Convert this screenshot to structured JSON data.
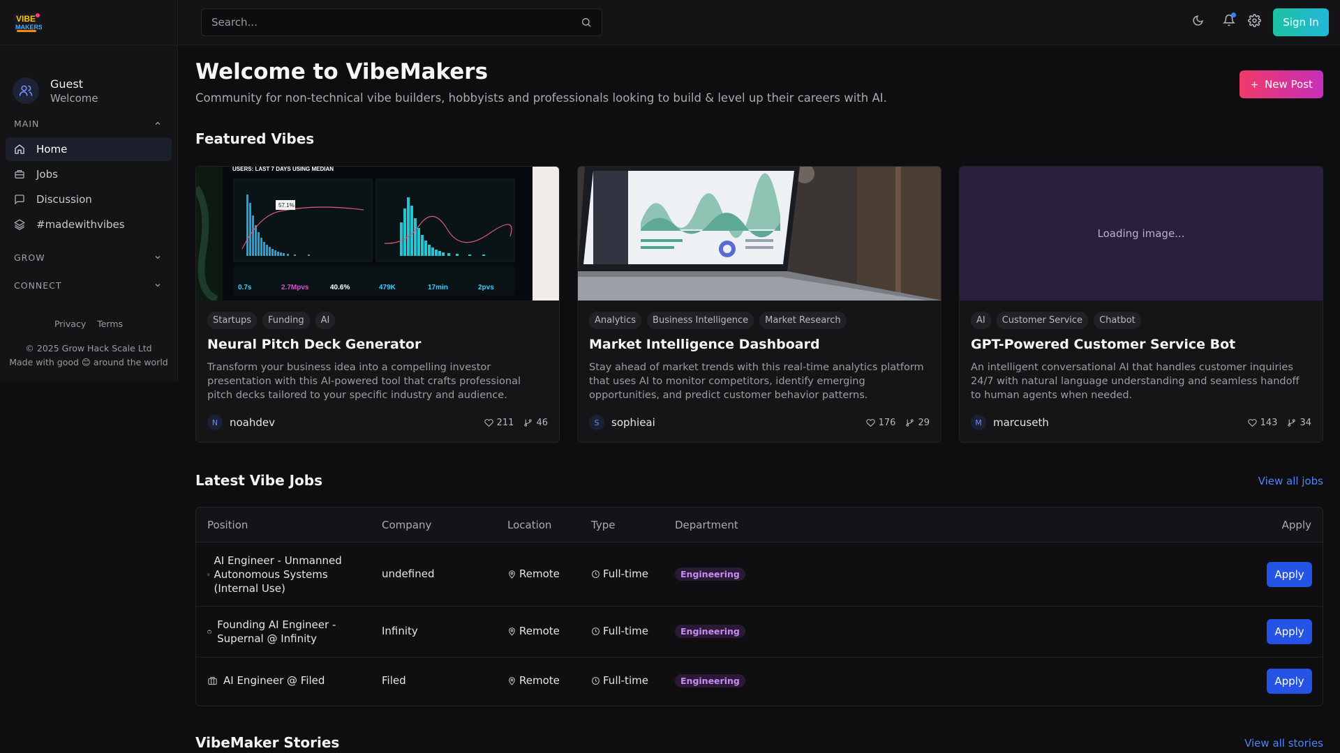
{
  "app": {
    "logo_text": "VIBE MAKERS",
    "search_placeholder": "Search...",
    "signin_label": "Sign In"
  },
  "sidebar": {
    "user": {
      "name": "Guest",
      "sub": "Welcome"
    },
    "sections": [
      {
        "label": "MAIN",
        "expanded": true
      },
      {
        "label": "GROW",
        "expanded": false
      },
      {
        "label": "CONNECT",
        "expanded": false
      }
    ],
    "items": [
      {
        "label": "Home",
        "icon": "home-icon",
        "active": true
      },
      {
        "label": "Jobs",
        "icon": "briefcase-icon",
        "active": false
      },
      {
        "label": "Discussion",
        "icon": "message-square-icon",
        "active": false
      },
      {
        "label": "#madewithvibes",
        "icon": "layers-icon",
        "active": false
      }
    ],
    "footer": {
      "privacy": "Privacy",
      "terms": "Terms",
      "copyright": "© 2025 Grow Hack Scale Ltd",
      "made_with": "Made with good 😊 around the world"
    }
  },
  "header": {
    "title": "Welcome to VibeMakers",
    "subtitle": "Community for non-technical vibe builders, hobbyists and professionals looking to build & level up their careers with AI.",
    "new_post_label": "New Post"
  },
  "featured": {
    "title": "Featured Vibes",
    "cards": [
      {
        "tags": [
          "Startups",
          "Funding",
          "AI"
        ],
        "title": "Neural Pitch Deck Generator",
        "description": "Transform your business idea into a compelling investor presentation with this AI-powered tool that crafts professional pitch decks tailored to your specific industry and audience.",
        "author_initial": "N",
        "author": "noahdev",
        "likes": "211",
        "forks": "46",
        "image": {
          "header": "USERS: LAST 7 DAYS USING MEDIAN",
          "tooltip": "57.1%",
          "metrics": [
            "0.7s",
            "2.7Mpvs",
            "40.6%",
            "479K",
            "17min",
            "2pvs"
          ]
        }
      },
      {
        "tags": [
          "Analytics",
          "Business Intelligence",
          "Market Research"
        ],
        "title": "Market Intelligence Dashboard",
        "description": "Stay ahead of market trends with this real-time analytics platform that uses AI to monitor competitors, identify emerging opportunities, and predict customer behavior patterns.",
        "author_initial": "S",
        "author": "sophieai",
        "likes": "176",
        "forks": "29"
      },
      {
        "tags": [
          "AI",
          "Customer Service",
          "Chatbot"
        ],
        "title": "GPT-Powered Customer Service Bot",
        "description": "An intelligent conversational AI that handles customer inquiries 24/7 with natural language understanding and seamless handoff to human agents when needed.",
        "author_initial": "M",
        "author": "marcuseth",
        "likes": "143",
        "forks": "34",
        "loading_text": "Loading image..."
      }
    ]
  },
  "jobs": {
    "title": "Latest Vibe Jobs",
    "view_all": "View all jobs",
    "columns": [
      "Position",
      "Company",
      "Location",
      "Type",
      "Department",
      "Apply"
    ],
    "rows": [
      {
        "position": "AI Engineer - Unmanned Autonomous Systems (Internal Use)",
        "company": "undefined",
        "location": "Remote",
        "type": "Full-time",
        "department": "Engineering",
        "apply": "Apply"
      },
      {
        "position": "Founding AI Engineer - Supernal @ Infinity",
        "company": "Infinity",
        "location": "Remote",
        "type": "Full-time",
        "department": "Engineering",
        "apply": "Apply"
      },
      {
        "position": "AI Engineer @ Filed",
        "company": "Filed",
        "location": "Remote",
        "type": "Full-time",
        "department": "Engineering",
        "apply": "Apply"
      }
    ]
  },
  "stories": {
    "title": "VibeMaker Stories",
    "view_all": "View all stories"
  }
}
